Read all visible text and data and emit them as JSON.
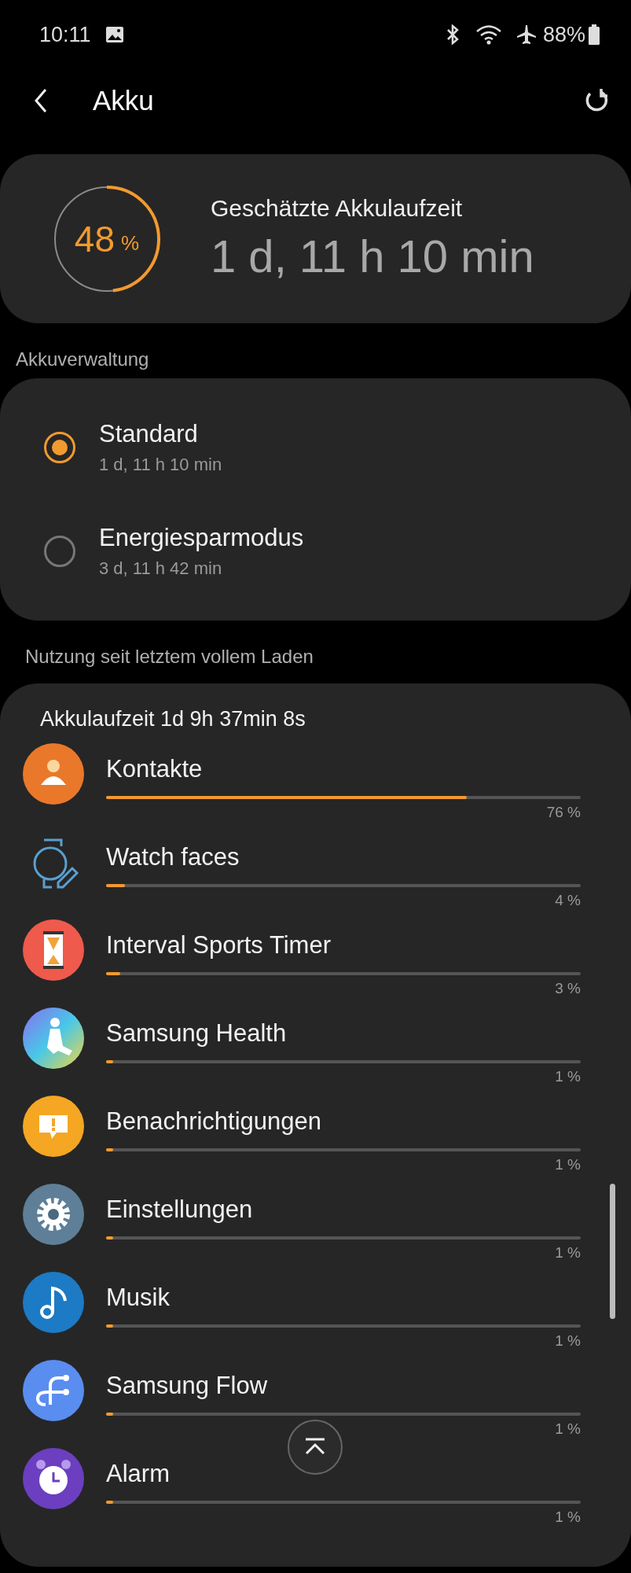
{
  "status_bar": {
    "time": "10:11",
    "battery": "88%"
  },
  "header": {
    "title": "Akku"
  },
  "battery_card": {
    "level": 0.48,
    "percent": "48",
    "percent_sign": "%",
    "label": "Geschätzte Akkulaufzeit",
    "estimate": "1 d, 11 h 10 min"
  },
  "management": {
    "heading": "Akkuverwaltung",
    "modes": [
      {
        "name": "Standard",
        "time": "1 d, 11 h 10 min",
        "selected": true
      },
      {
        "name": "Energiesparmodus",
        "time": "3 d, 11 h 42 min",
        "selected": false
      }
    ]
  },
  "usage": {
    "heading": "Nutzung seit letztem vollem Laden",
    "runtime": "Akkulaufzeit 1d 9h 37min 8s",
    "apps": [
      {
        "name": "Kontakte",
        "level": 0.76,
        "percent": "76 %"
      },
      {
        "name": "Watch faces",
        "level": 0.04,
        "percent": "4 %"
      },
      {
        "name": "Interval Sports Timer",
        "level": 0.03,
        "percent": "3 %"
      },
      {
        "name": "Samsung Health",
        "level": 0.01,
        "percent": "1 %"
      },
      {
        "name": "Benachrichtigungen",
        "level": 0.01,
        "percent": "1 %"
      },
      {
        "name": "Einstellungen",
        "level": 0.01,
        "percent": "1 %"
      },
      {
        "name": "Musik",
        "level": 0.01,
        "percent": "1 %"
      },
      {
        "name": "Samsung Flow",
        "level": 0.01,
        "percent": "1 %"
      },
      {
        "name": "Alarm",
        "level": 0.01,
        "percent": "1 %"
      }
    ]
  }
}
